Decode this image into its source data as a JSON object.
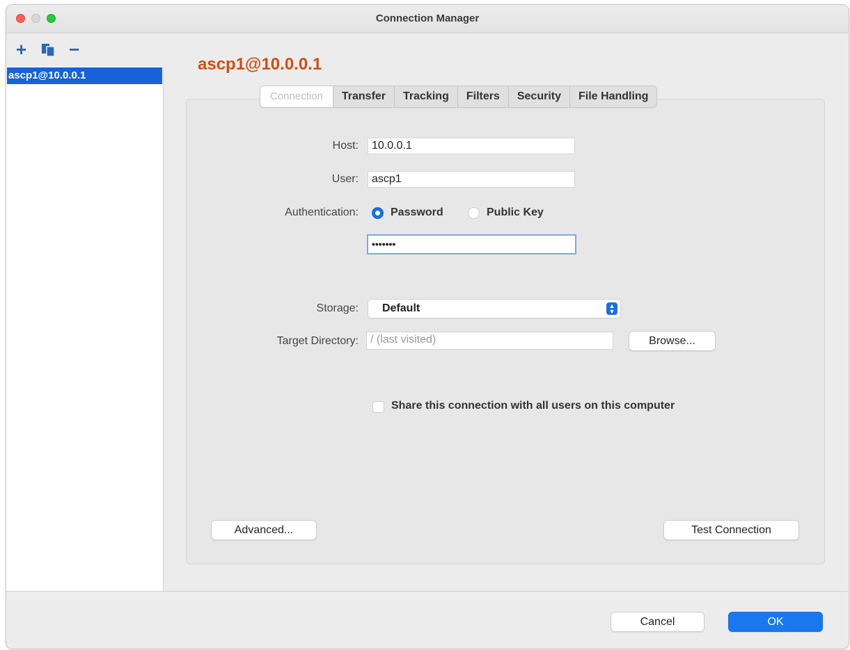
{
  "window": {
    "title": "Connection Manager"
  },
  "sidebar": {
    "tools": {
      "add": "+",
      "copy": "▮",
      "remove": "−"
    },
    "items": [
      {
        "label": "ascp1@10.0.0.1"
      }
    ]
  },
  "connection": {
    "title": "ascp1@10.0.0.1",
    "tabs": [
      {
        "label": "Connection",
        "active": true
      },
      {
        "label": "Transfer"
      },
      {
        "label": "Tracking"
      },
      {
        "label": "Filters"
      },
      {
        "label": "Security"
      },
      {
        "label": "File Handling"
      }
    ],
    "host": {
      "label": "Host:",
      "value": "10.0.0.1"
    },
    "user": {
      "label": "User:",
      "value": "ascp1"
    },
    "authentication": {
      "label": "Authentication:",
      "options": [
        {
          "label": "Password",
          "selected": true
        },
        {
          "label": "Public Key",
          "selected": false
        }
      ],
      "password_value": "•••••••"
    },
    "storage": {
      "label": "Storage:",
      "selected": "Default"
    },
    "target_directory": {
      "label": "Target Directory:",
      "placeholder": "/ (last visited)",
      "browse_label": "Browse..."
    },
    "share": {
      "label": "Share this connection with all users on this computer",
      "checked": false
    },
    "advanced_label": "Advanced...",
    "test_label": "Test Connection"
  },
  "footer": {
    "cancel_label": "Cancel",
    "ok_label": "OK"
  },
  "colors": {
    "accent": "#1a6fe0",
    "title_orange": "#d14f10",
    "selection": "#1663d8"
  }
}
